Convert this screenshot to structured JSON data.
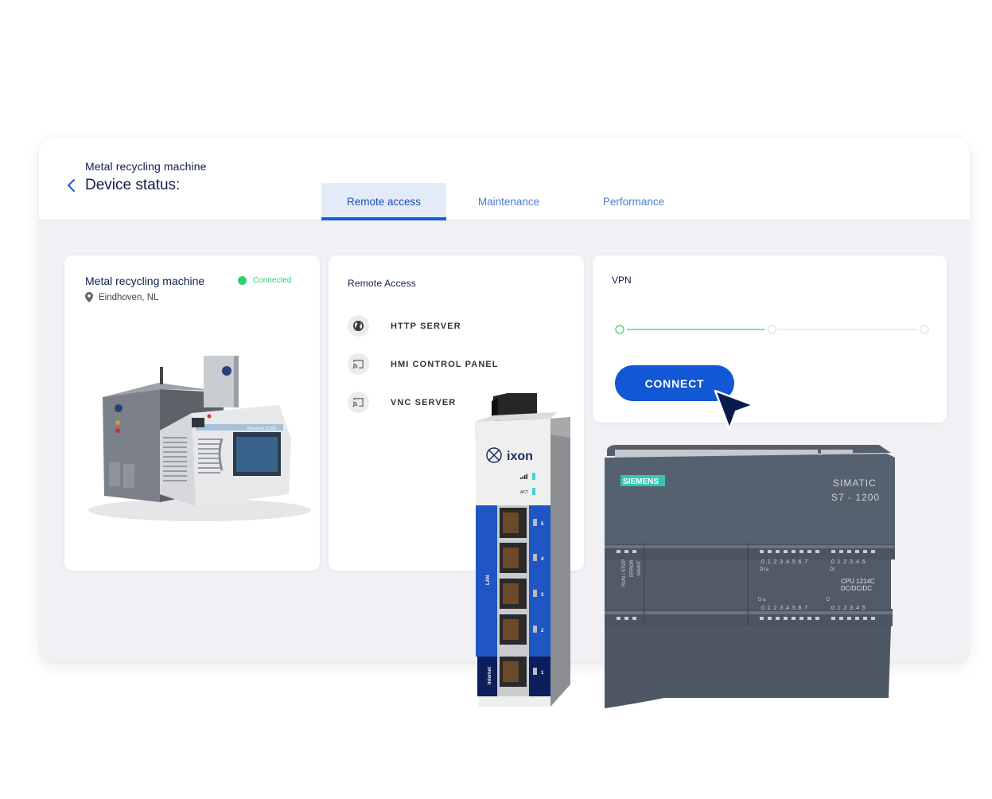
{
  "header": {
    "subtitle": "Metal recycling machine",
    "title": "Device status:",
    "back_icon": "chevron-left-icon"
  },
  "tabs": [
    {
      "label": "Remote access",
      "active": true
    },
    {
      "label": "Maintenance",
      "active": false
    },
    {
      "label": "Performance",
      "active": false
    }
  ],
  "machine_card": {
    "name": "Metal recycling machine",
    "status": "Connected",
    "status_color": "#2fcf6e",
    "location": "Eindhoven, NL",
    "location_icon": "map-pin-icon",
    "machine_label": "BlueLine S150"
  },
  "remote_access": {
    "title": "Remote Access",
    "items": [
      {
        "label": "HTTP SERVER",
        "icon": "globe-icon"
      },
      {
        "label": "HMI CONTROL PANEL",
        "icon": "cast-icon"
      },
      {
        "label": "VNC SERVER",
        "icon": "cast-icon"
      }
    ]
  },
  "vpn": {
    "title": "VPN",
    "steps_total": 3,
    "steps_completed": 1,
    "connect_label": "CONNECT"
  },
  "colors": {
    "accent": "#1257d3",
    "navy": "#0f1d4d",
    "success": "#2fcf6e",
    "tab_active_bg": "#e4ebf8",
    "panel_bg": "#f1f0f5"
  },
  "ixon_device": {
    "brand": "ixon",
    "indicators": [
      "signal",
      "ACT"
    ],
    "lan_label": "LAN",
    "internet_label": "Internet",
    "ports": [
      "5",
      "4",
      "3",
      "2",
      "1"
    ]
  },
  "siemens_plc": {
    "brand": "SIEMENS",
    "series": "SIMATIC",
    "model": "S7 - 1200",
    "cpu": "CPU 1214C",
    "cpu_type": "DC/DC/DC",
    "status_leds": [
      "RUN / STOP",
      "ERROR",
      "MAINT"
    ],
    "di_a": ".0 .1 .2 .3 .4 .5 .6 .7",
    "di_b": ".0 .1 .2 .3 .4 .5",
    "di_a_label": "DI a",
    "di_b_label": "DI",
    "dq_a": ".0 .1 .2 .3 .4 .5 .6 .7",
    "dq_b": ".0 .1 .2 .3 .4 .5",
    "dq_a_label": "D a",
    "dq_b_label": "D"
  }
}
